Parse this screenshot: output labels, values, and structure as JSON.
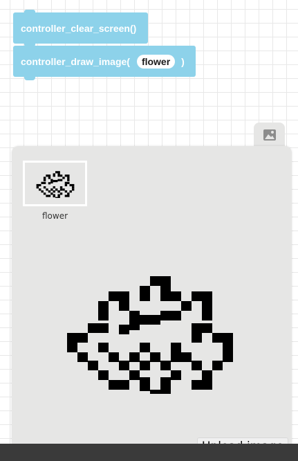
{
  "blocks": {
    "clear_screen": {
      "label": "controller_clear_screen()"
    },
    "draw_image": {
      "label": "controller_draw_image(",
      "param": "flower",
      "close": ")"
    }
  },
  "image_panel": {
    "tab_icon": "image-icon",
    "images": [
      {
        "name": "flower",
        "selected": true
      }
    ],
    "upload_label": "Upload image"
  },
  "colors": {
    "block": "#8dd2ea",
    "panel": "#e6e6e5",
    "pixel": "#000000"
  }
}
